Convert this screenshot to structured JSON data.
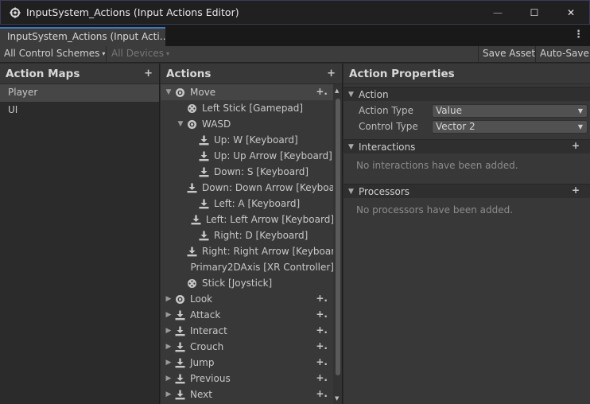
{
  "window": {
    "title": "InputSystem_Actions (Input Actions Editor)",
    "tab_label": "InputSystem_Actions (Input Acti…",
    "min_glyph": "—",
    "max_glyph": "☐",
    "close_glyph": "✕",
    "menu_glyph": "⋮"
  },
  "toolbar": {
    "control_schemes": "All Control Schemes",
    "devices": "All Devices",
    "save_asset": "Save Asset",
    "auto_save": "Auto-Save",
    "caret": "▾"
  },
  "action_maps": {
    "header": "Action Maps",
    "add": "+",
    "items": [
      {
        "label": "Player"
      },
      {
        "label": "UI"
      }
    ]
  },
  "actions": {
    "header": "Actions",
    "add": "+",
    "add_binding": "+.",
    "tree": [
      {
        "label": "Move",
        "icon": "action-icon"
      },
      {
        "label": "Left Stick [Gamepad]",
        "icon": "gamepad-binding-icon"
      },
      {
        "label": "WASD",
        "icon": "action-icon"
      },
      {
        "label": "Up: W [Keyboard]",
        "icon": "binding-icon"
      },
      {
        "label": "Up: Up Arrow [Keyboard]",
        "icon": "binding-icon"
      },
      {
        "label": "Down: S [Keyboard]",
        "icon": "binding-icon"
      },
      {
        "label": "Down: Down Arrow [Keyboard]",
        "icon": "binding-icon"
      },
      {
        "label": "Left: A [Keyboard]",
        "icon": "binding-icon"
      },
      {
        "label": "Left: Left Arrow [Keyboard]",
        "icon": "binding-icon"
      },
      {
        "label": "Right: D [Keyboard]",
        "icon": "binding-icon"
      },
      {
        "label": "Right: Right Arrow [Keyboard]",
        "icon": "binding-icon"
      },
      {
        "label": "Primary2DAxis [XR Controller]",
        "icon": "none"
      },
      {
        "label": "Stick [Joystick]",
        "icon": "gamepad-binding-icon"
      },
      {
        "label": "Look",
        "icon": "action-icon"
      },
      {
        "label": "Attack",
        "icon": "binding-icon"
      },
      {
        "label": "Interact",
        "icon": "binding-icon"
      },
      {
        "label": "Crouch",
        "icon": "binding-icon"
      },
      {
        "label": "Jump",
        "icon": "binding-icon"
      },
      {
        "label": "Previous",
        "icon": "binding-icon"
      },
      {
        "label": "Next",
        "icon": "binding-icon"
      }
    ]
  },
  "properties": {
    "header": "Action Properties",
    "action_section": "Action",
    "action_type_label": "Action Type",
    "action_type_value": "Value",
    "control_type_label": "Control Type",
    "control_type_value": "Vector 2",
    "interactions_section": "Interactions",
    "interactions_empty": "No interactions have been added.",
    "processors_section": "Processors",
    "processors_empty": "No processors have been added.",
    "add": "+"
  }
}
